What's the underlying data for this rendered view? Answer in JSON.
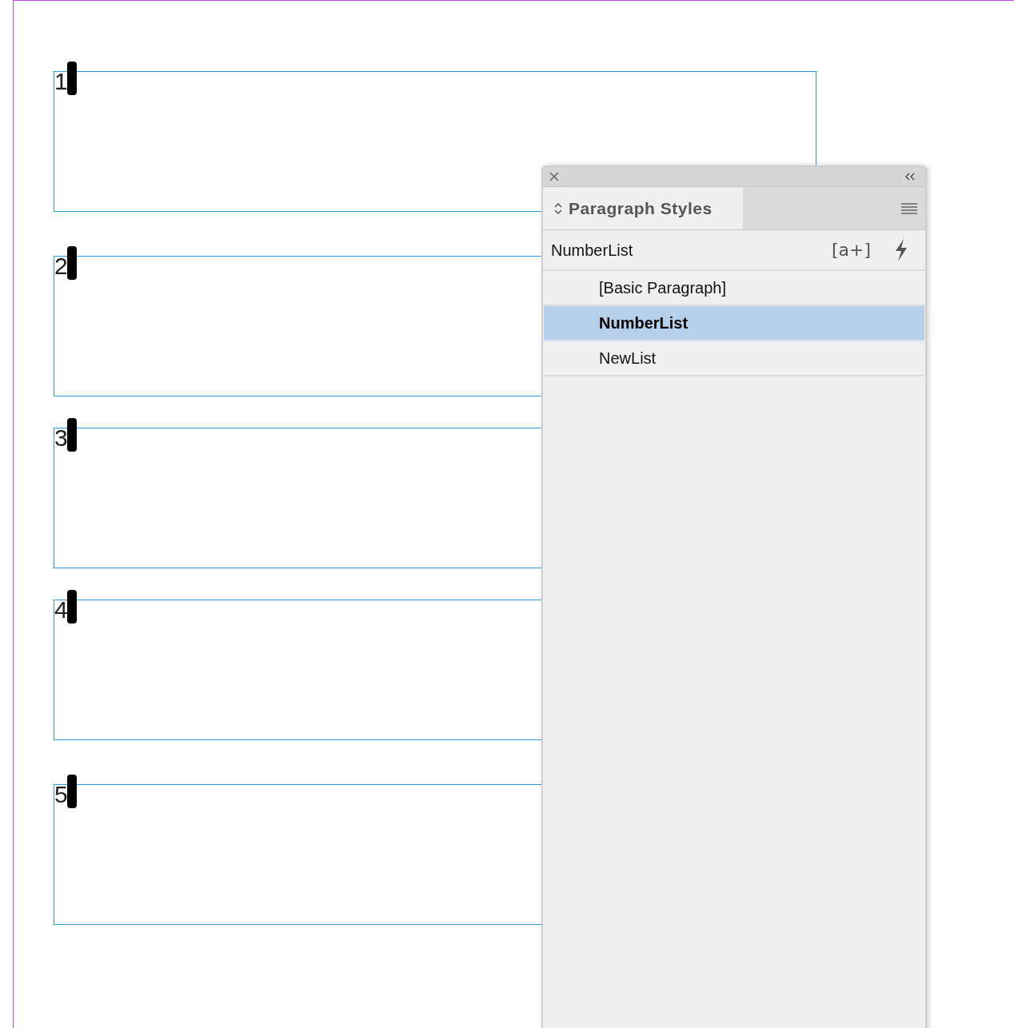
{
  "frames": [
    {
      "number": "1"
    },
    {
      "number": "2"
    },
    {
      "number": "3"
    },
    {
      "number": "4"
    },
    {
      "number": "5"
    }
  ],
  "panel": {
    "tab": {
      "label": "Paragraph Styles",
      "selected": true
    },
    "current_style": "NumberList",
    "new_group_button": "[a+]",
    "styles": [
      {
        "name": "[Basic Paragraph]",
        "selected": false
      },
      {
        "name": "NumberList",
        "selected": true
      },
      {
        "name": "NewList",
        "selected": false
      }
    ]
  }
}
